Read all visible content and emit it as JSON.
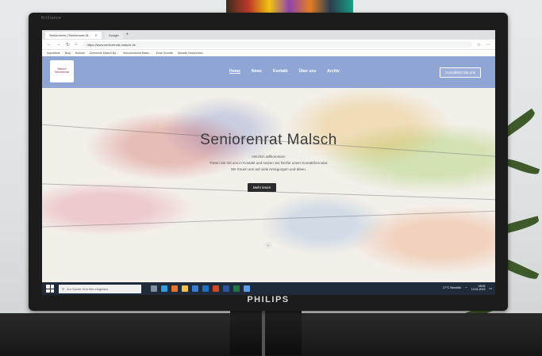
{
  "monitor": {
    "brand": "PHILIPS",
    "corner_label": "Brilliance"
  },
  "browser": {
    "tabs": [
      {
        "label": "Seniorenrat | Seniorenrat M...",
        "active": true
      },
      {
        "label": "Google",
        "active": false
      }
    ],
    "url": "https://www.seniorenrat-malsch.de",
    "bookmarks": [
      "Importierte",
      "Bing",
      "Hotmail",
      "Gemeinde Malsch Ba...",
      "Seniorenbeirat Malsc...",
      "Erste Schritte",
      "Aktuelle Nachrichten"
    ]
  },
  "site": {
    "logo_text": "Malsch Seniorenrat",
    "nav": [
      "Home",
      "News",
      "Kontakt",
      "Über uns",
      "Archiv"
    ],
    "contact_button": "Kontaktiert Sie uns",
    "hero": {
      "title": "Seniorenrat Malsch",
      "greeting": "Herzlich willkommen!",
      "line1": "Treten Sie mit uns in Kontakt und nutzen Sie hierfür unser Kontaktformular.",
      "line2": "Wir freuen uns auf viele Anregungen und Ideen.",
      "button": "Mehr lesen"
    }
  },
  "taskbar": {
    "search_placeholder": "Zur Suche Text hier eingeben",
    "weather": "17°C Bewölkt",
    "time": "08:55",
    "date": "13.01.2023"
  },
  "colors": {
    "header_blue": "#8fa6d4",
    "taskbar": "#1f2a3a",
    "button_dark": "#2b2b2b"
  }
}
